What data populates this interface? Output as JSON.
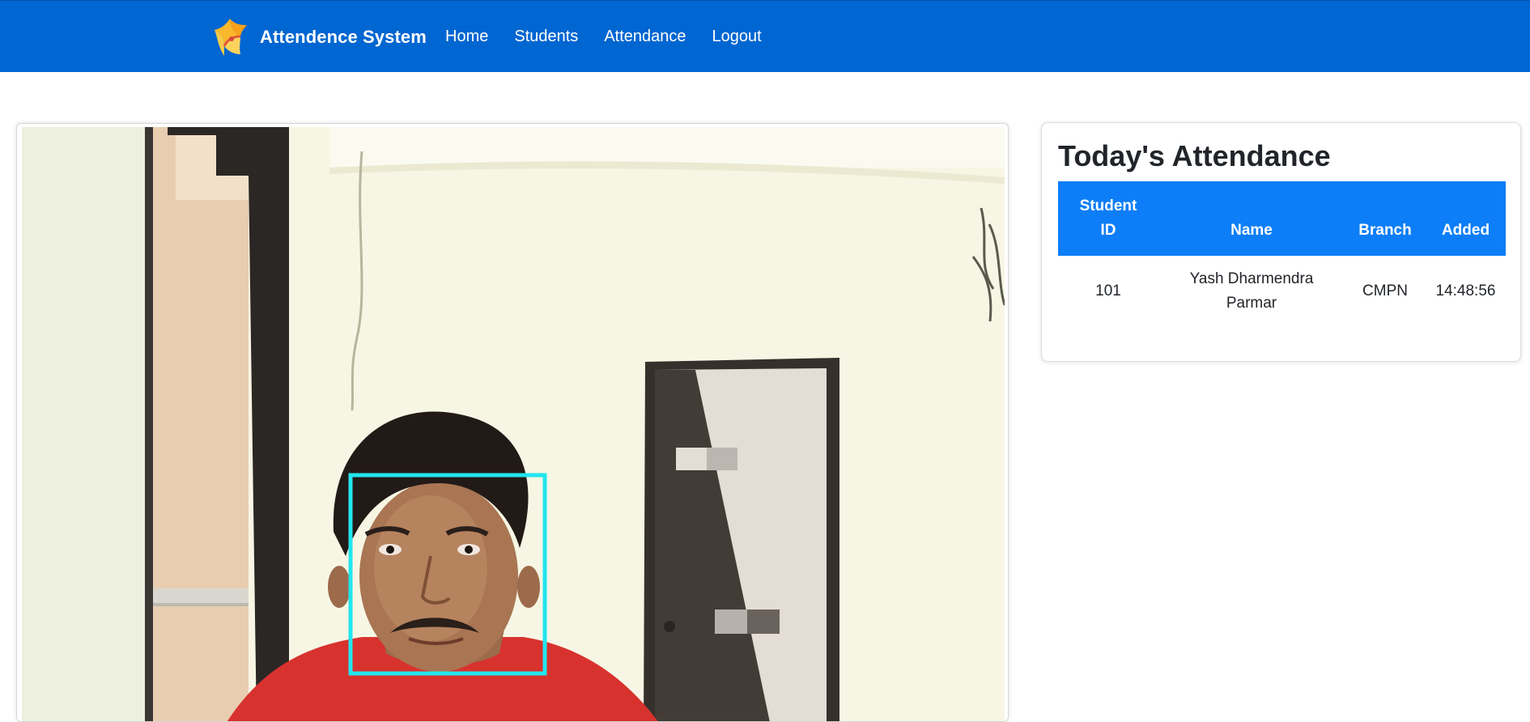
{
  "navbar": {
    "brand": "Attendence System",
    "links": [
      "Home",
      "Students",
      "Attendance",
      "Logout"
    ]
  },
  "camera": {
    "overlay_color": "#22e6ee"
  },
  "attendance": {
    "title": "Today's Attendance",
    "columns": [
      "Student ID",
      "Name",
      "Branch",
      "Added"
    ],
    "rows": [
      {
        "id": "101",
        "name": "Yash Dharmendra Parmar",
        "branch": "CMPN",
        "added": "14:48:56"
      }
    ]
  },
  "colors": {
    "navbar": "#0066d1",
    "table_header": "#0d7ef7"
  }
}
